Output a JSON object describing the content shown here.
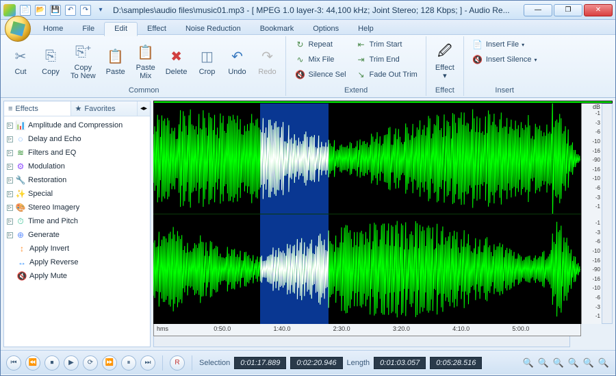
{
  "title": "D:\\samples\\audio files\\music01.mp3 - [ MPEG 1.0 layer-3: 44,100 kHz; Joint Stereo; 128 Kbps;  ] - Audio Re...",
  "qat": [
    "new",
    "open",
    "save",
    "undo",
    "redo"
  ],
  "tabs": [
    "Home",
    "File",
    "Edit",
    "Effect",
    "Noise Reduction",
    "Bookmark",
    "Options",
    "Help"
  ],
  "active_tab": 2,
  "ribbon": {
    "common": {
      "label": "Common",
      "items": [
        {
          "id": "cut",
          "label": "Cut",
          "glyph": "✂"
        },
        {
          "id": "copy",
          "label": "Copy",
          "glyph": "⎘"
        },
        {
          "id": "copy-to-new",
          "label": "Copy\nTo New",
          "glyph": "⎘⁺"
        },
        {
          "id": "paste",
          "label": "Paste",
          "glyph": "📋"
        },
        {
          "id": "paste-mix",
          "label": "Paste\nMix",
          "glyph": "📋"
        },
        {
          "id": "delete",
          "label": "Delete",
          "glyph": "✖"
        },
        {
          "id": "crop",
          "label": "Crop",
          "glyph": "◫"
        },
        {
          "id": "undo",
          "label": "Undo",
          "glyph": "↶"
        },
        {
          "id": "redo",
          "label": "Redo",
          "glyph": "↷"
        }
      ]
    },
    "extend": {
      "label": "Extend",
      "items": [
        {
          "id": "repeat",
          "label": "Repeat",
          "glyph": "↻"
        },
        {
          "id": "mix-file",
          "label": "Mix File",
          "glyph": "∿"
        },
        {
          "id": "silence-sel",
          "label": "Silence Sel",
          "glyph": "🔇"
        },
        {
          "id": "trim-start",
          "label": "Trim Start",
          "glyph": "⇤"
        },
        {
          "id": "trim-end",
          "label": "Trim End",
          "glyph": "⇥"
        },
        {
          "id": "fade-out-trim",
          "label": "Fade Out Trim",
          "glyph": "↘"
        }
      ]
    },
    "effect": {
      "label": "Effect",
      "id": "effect",
      "btn": "Effect",
      "glyph": "✎"
    },
    "insert": {
      "label": "Insert",
      "items": [
        {
          "id": "insert-file",
          "label": "Insert File",
          "glyph": "📄"
        },
        {
          "id": "insert-silence",
          "label": "Insert Silence",
          "glyph": "🔇"
        }
      ]
    }
  },
  "sidebar": {
    "tabs": [
      {
        "id": "effects",
        "label": "Effects",
        "glyph": "≡"
      },
      {
        "id": "favorites",
        "label": "Favorites",
        "glyph": "★"
      }
    ],
    "active": 0,
    "items": [
      {
        "exp": true,
        "icon": "📊",
        "label": "Amplitude and Compression",
        "color": "#ff8f2f"
      },
      {
        "exp": true,
        "icon": "◌",
        "label": "Delay and Echo",
        "color": "#2f8fff"
      },
      {
        "exp": true,
        "icon": "≋",
        "label": "Filters and EQ",
        "color": "#2f8f2f"
      },
      {
        "exp": true,
        "icon": "⚙",
        "label": "Modulation",
        "color": "#8f4fff"
      },
      {
        "exp": true,
        "icon": "🔧",
        "label": "Restoration",
        "color": "#8f2f2f"
      },
      {
        "exp": true,
        "icon": "✨",
        "label": "Special",
        "color": "#ff5f2f"
      },
      {
        "exp": true,
        "icon": "🎨",
        "label": "Stereo Imagery",
        "color": "#ff2f8f"
      },
      {
        "exp": true,
        "icon": "⏱",
        "label": "Time and Pitch",
        "color": "#2fbf8f"
      },
      {
        "exp": true,
        "icon": "⊕",
        "label": "Generate",
        "color": "#5f8fff"
      },
      {
        "exp": false,
        "icon": "↕",
        "label": "Apply Invert",
        "color": "#ff8f2f"
      },
      {
        "exp": false,
        "icon": "↔",
        "label": "Apply Reverse",
        "color": "#2f8fff"
      },
      {
        "exp": false,
        "icon": "🔇",
        "label": "Apply Mute",
        "color": "#8f8f8f"
      }
    ]
  },
  "scale": {
    "unit": "dB",
    "ticks": [
      "-1",
      "-3",
      "-6",
      "-10",
      "-16",
      "-90",
      "-16",
      "-10",
      "-6",
      "-3",
      "-1"
    ]
  },
  "time": {
    "unit": "hms",
    "ticks": [
      {
        "pos": 14,
        "label": "0:50.0"
      },
      {
        "pos": 28,
        "label": "1:40.0"
      },
      {
        "pos": 42,
        "label": "2:30.0"
      },
      {
        "pos": 56,
        "label": "3:20.0"
      },
      {
        "pos": 70,
        "label": "4:10.0"
      },
      {
        "pos": 84,
        "label": "5:00.0"
      }
    ]
  },
  "status": {
    "selection_label": "Selection",
    "sel_start": "0:01:17.889",
    "sel_end": "0:02:20.946",
    "length_label": "Length",
    "len_sel": "0:01:03.057",
    "len_total": "0:05:28.516"
  }
}
